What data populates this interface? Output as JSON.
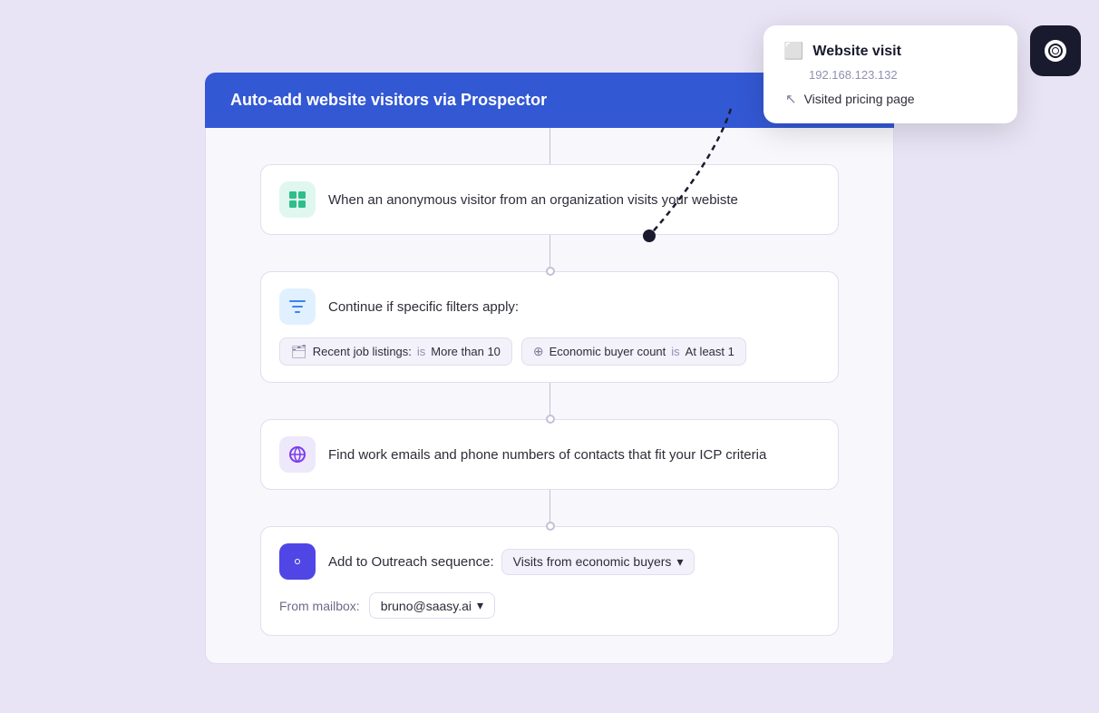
{
  "page": {
    "background": "#e8e4f5"
  },
  "header": {
    "title": "Auto-add website visitors via Prospector"
  },
  "popup": {
    "title": "Website visit",
    "ip": "192.168.123.132",
    "detail": "Visited pricing page",
    "icon": "🖥"
  },
  "steps": [
    {
      "id": "step-trigger",
      "icon": "▦",
      "icon_style": "green",
      "label": "When an anonymous visitor from an organization visits your webiste"
    },
    {
      "id": "step-filter",
      "icon": "⊘",
      "icon_style": "blue-light",
      "label": "Continue if specific filters apply:",
      "filters": [
        {
          "icon": "🗂",
          "key": "Recent job listings:",
          "op": "is",
          "val": "More than 10"
        },
        {
          "icon": "⊕",
          "key": "Economic buyer count",
          "op": "is",
          "val": "At least 1"
        }
      ]
    },
    {
      "id": "step-find",
      "icon": "🌐",
      "icon_style": "globe",
      "label": "Find work emails and phone numbers of contacts that fit your ICP criteria"
    },
    {
      "id": "step-outreach",
      "icon": "▶",
      "icon_style": "purple",
      "label_prefix": "Add to Outreach sequence:",
      "sequence_name": "Visits from economic buyers",
      "from_mailbox_label": "From mailbox:",
      "mailbox_value": "bruno@saasy.ai"
    }
  ],
  "icons": {
    "prospector": "ꩥ",
    "dropdown_arrow": "▾",
    "browser": "⬜",
    "cursor": "↖"
  }
}
